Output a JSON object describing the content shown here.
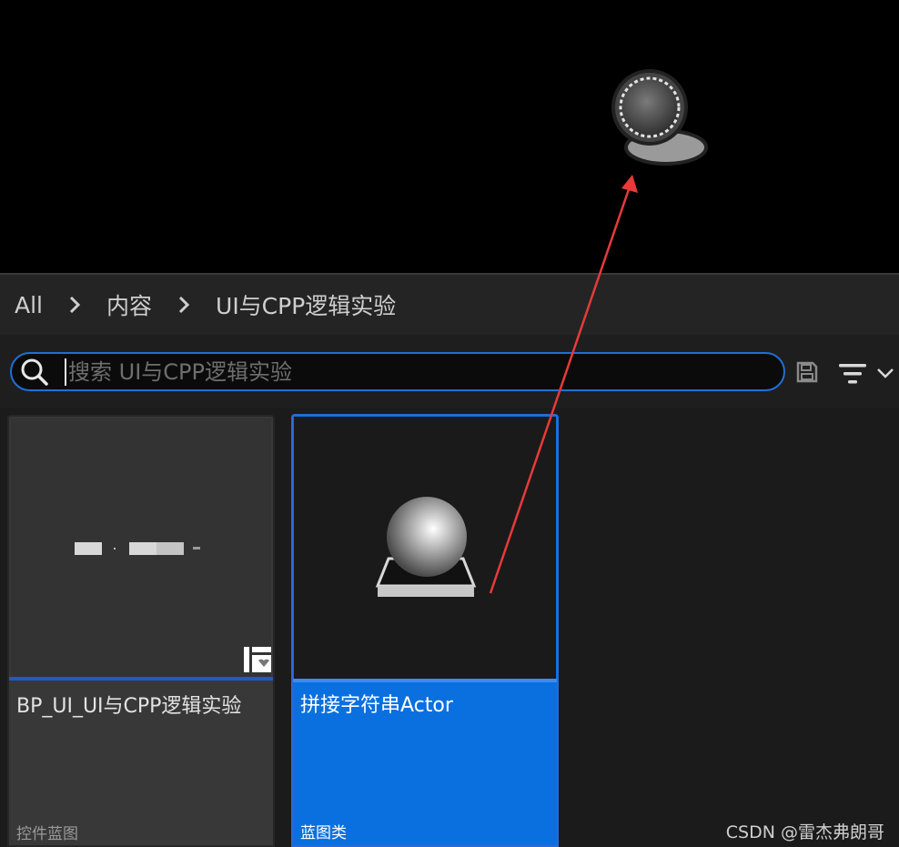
{
  "breadcrumb": {
    "items": [
      "All",
      "内容",
      "UI与CPP逻辑实验"
    ]
  },
  "search": {
    "placeholder": "搜索 UI与CPP逻辑实验",
    "value": ""
  },
  "assets": [
    {
      "name": "BP_UI_UI与CPP逻辑实验",
      "type": "控件蓝图",
      "thumbnail_icon": "widget-blueprint-preview",
      "selected": false
    },
    {
      "name": "拼接字符串Actor",
      "type": "蓝图类",
      "thumbnail_icon": "sphere-actor-preview",
      "selected": true
    }
  ],
  "annotation": {
    "arrow_color": "#e83a3a"
  },
  "watermark": "CSDN @雷杰弗朗哥",
  "colors": {
    "accent": "#0a70df",
    "viewport": "#000000",
    "panel": "#1b1b1b"
  }
}
